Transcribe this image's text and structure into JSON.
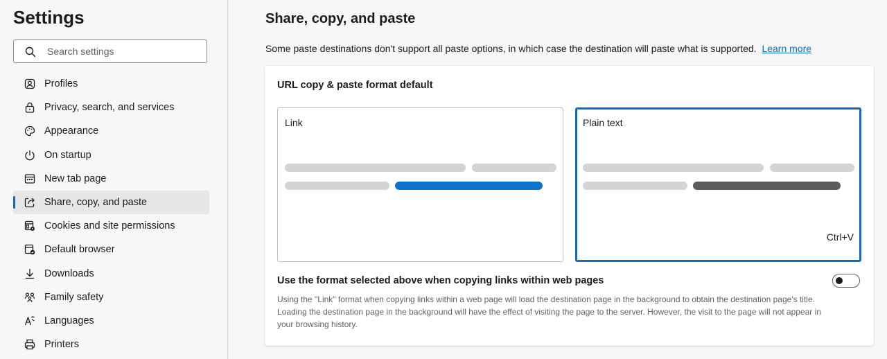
{
  "sidebar": {
    "title": "Settings",
    "search_placeholder": "Search settings",
    "items": [
      {
        "label": "Profiles",
        "icon": "profile-icon"
      },
      {
        "label": "Privacy, search, and services",
        "icon": "lock-icon"
      },
      {
        "label": "Appearance",
        "icon": "palette-icon"
      },
      {
        "label": "On startup",
        "icon": "power-icon"
      },
      {
        "label": "New tab page",
        "icon": "new-tab-icon"
      },
      {
        "label": "Share, copy, and paste",
        "icon": "share-icon",
        "active": true
      },
      {
        "label": "Cookies and site permissions",
        "icon": "cookies-icon"
      },
      {
        "label": "Default browser",
        "icon": "browser-icon"
      },
      {
        "label": "Downloads",
        "icon": "download-icon"
      },
      {
        "label": "Family safety",
        "icon": "family-icon"
      },
      {
        "label": "Languages",
        "icon": "languages-icon"
      },
      {
        "label": "Printers",
        "icon": "printer-icon"
      }
    ]
  },
  "main": {
    "title": "Share, copy, and paste",
    "description": "Some paste destinations don't support all paste options, in which case the destination will paste what is supported.",
    "learn_more": "Learn more",
    "card": {
      "heading": "URL copy & paste format default",
      "options": {
        "link": {
          "label": "Link",
          "selected": false
        },
        "plain": {
          "label": "Plain text",
          "selected": true,
          "shortcut": "Ctrl+V"
        }
      },
      "setting": {
        "title": "Use the format selected above when copying links within web pages",
        "description": "Using the \"Link\" format when copying links within a web page will load the destination page in the background to obtain the destination page's title. Loading the destination page in the background will have the effect of visiting the page to the server. However, the visit to the page will not appear in your browsing history.",
        "toggle_on": false
      }
    }
  },
  "colors": {
    "accent": "#0f6cbd",
    "link_bar": "#0a74cc",
    "plain_bar": "#5c5c5c",
    "placeholder_bar": "#d4d4d4"
  }
}
